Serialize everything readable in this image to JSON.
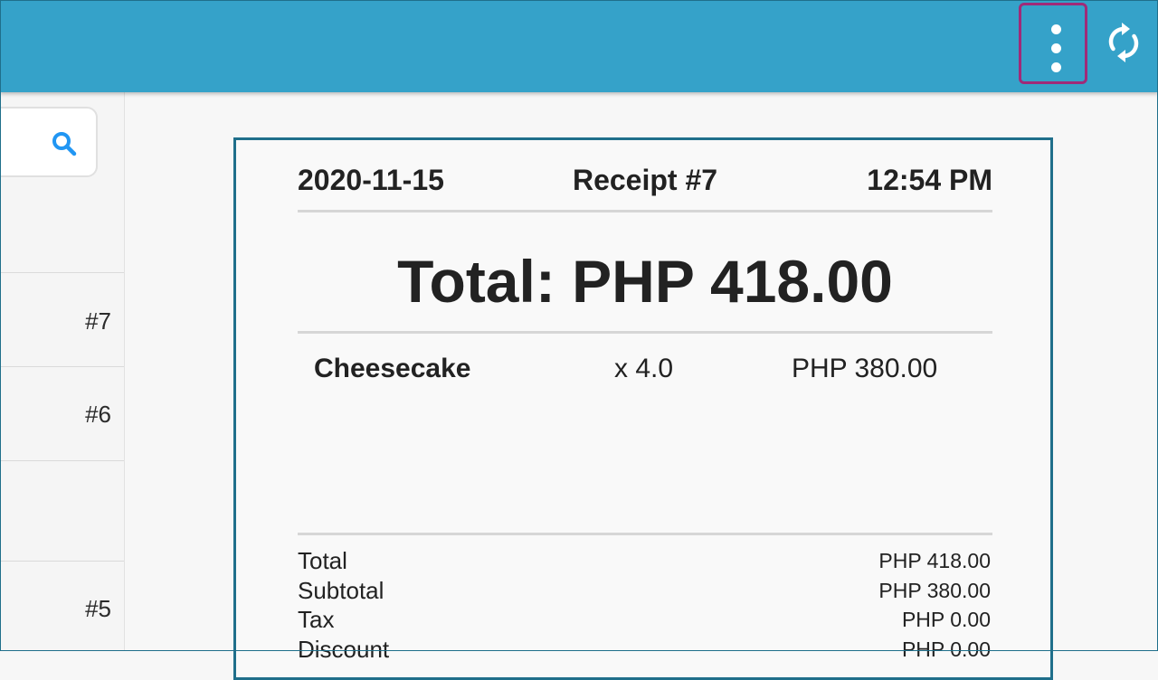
{
  "appbar": {
    "background": "#35a2c9",
    "menu_icon": "more-vert-icon",
    "sync_icon": "sync-icon",
    "highlight_color": "#a02a78"
  },
  "left_panel": {
    "search_icon": "search-icon",
    "receipts": [
      {
        "number": "#7"
      },
      {
        "number": "#6"
      },
      {
        "number": "#5"
      }
    ]
  },
  "receipt": {
    "date": "2020-11-15",
    "receipt_no": "Receipt #7",
    "time": "12:54 PM",
    "total_line": "Total: PHP 418.00",
    "items": [
      {
        "name": "Cheesecake",
        "qty": "x 4.0",
        "price": "PHP 380.00"
      }
    ],
    "summary": [
      {
        "label": "Total",
        "value": "PHP 418.00"
      },
      {
        "label": "Subtotal",
        "value": "PHP 380.00"
      },
      {
        "label": "Tax",
        "value": "PHP 0.00"
      },
      {
        "label": "Discount",
        "value": "PHP 0.00"
      }
    ]
  }
}
